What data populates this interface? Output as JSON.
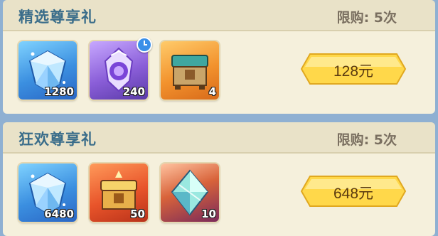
{
  "packs": [
    {
      "title": "精选尊享礼",
      "limit": "限购: 5次",
      "price": "128元",
      "items": [
        {
          "icon": "blue-diamond-icon",
          "count": "1280"
        },
        {
          "icon": "purple-crystal-emblem-icon",
          "count": "240",
          "badge": "clock-icon"
        },
        {
          "icon": "treasure-chest-icon",
          "count": "4"
        }
      ]
    },
    {
      "title": "狂欢尊享礼",
      "limit": "限购: 5次",
      "price": "648元",
      "items": [
        {
          "icon": "blue-diamond-icon",
          "count": "6480"
        },
        {
          "icon": "golden-chest-icon",
          "count": "50"
        },
        {
          "icon": "glowing-gem-icon",
          "count": "10"
        }
      ]
    }
  ],
  "colors": {
    "background": "#8fb0d2",
    "card": "#f5f0dc",
    "title": "#3a6d8a",
    "button": "#ffd84a"
  }
}
